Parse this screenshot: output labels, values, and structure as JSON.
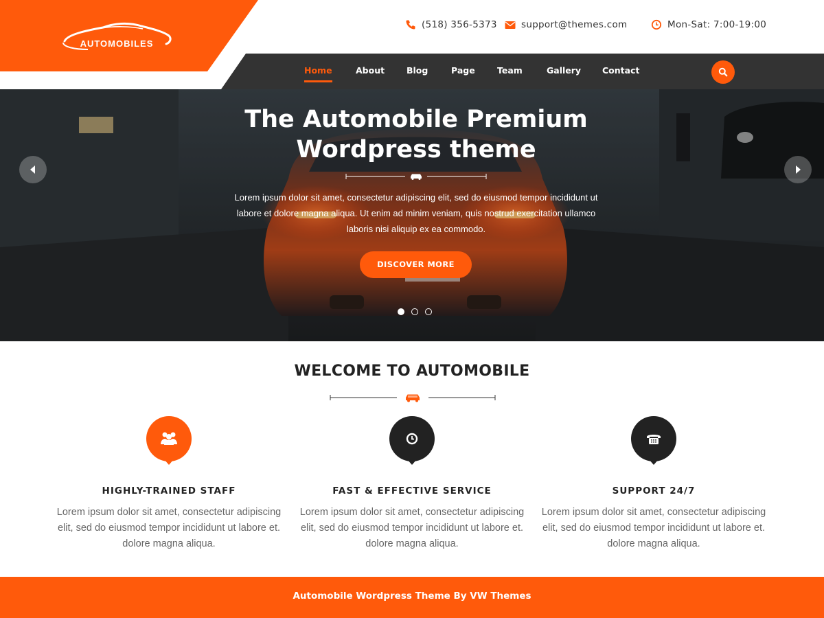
{
  "brand": {
    "name": "AUTOMOBILES",
    "accent": "#ff5a0b",
    "dark": "#333333"
  },
  "topbar": {
    "phone": "(518) 356-5373",
    "email": "support@themes.com",
    "hours": "Mon-Sat: 7:00-19:00",
    "phone_icon": "phone-icon",
    "email_icon": "envelope-icon",
    "hours_icon": "clock-icon"
  },
  "nav": {
    "items": [
      {
        "label": "Home",
        "active": true
      },
      {
        "label": "About",
        "active": false
      },
      {
        "label": "Blog",
        "active": false
      },
      {
        "label": "Page",
        "active": false
      },
      {
        "label": "Team",
        "active": false
      },
      {
        "label": "Gallery",
        "active": false
      },
      {
        "label": "Contact",
        "active": false
      }
    ],
    "search_icon": "search-icon"
  },
  "hero": {
    "title_line1": "The Automobile Premium",
    "title_line2": "Wordpress theme",
    "description": "Lorem ipsum dolor sit amet, consectetur adipiscing elit, sed do eiusmod tempor incididunt ut labore et dolore magna aliqua. Ut enim ad minim veniam, quis nostrud exercitation ullamco laboris nisi aliquip ex ea commodo.",
    "button_label": "DISCOVER MORE",
    "slides": 3,
    "active_slide": 1
  },
  "welcome": {
    "title": "WELCOME TO AUTOMOBILE",
    "features": [
      {
        "icon": "group-icon",
        "color": "#ff5a0b",
        "title": "HIGHLY-TRAINED STAFF",
        "text": "Lorem ipsum dolor sit amet, consectetur adipiscing elit, sed do eiusmod tempor incididunt ut labore et. dolore magna aliqua."
      },
      {
        "icon": "clock-icon",
        "color": "#222222",
        "title": "FAST & EFFECTIVE SERVICE",
        "text": "Lorem ipsum dolor sit amet, consectetur adipiscing elit, sed do eiusmod tempor incididunt ut labore et. dolore magna aliqua."
      },
      {
        "icon": "telephone-icon",
        "color": "#222222",
        "title": "SUPPORT 24/7",
        "text": "Lorem ipsum dolor sit amet, consectetur adipiscing elit, sed do eiusmod tempor incididunt ut labore et. dolore magna aliqua."
      }
    ]
  },
  "footer": {
    "text": "Automobile Wordpress Theme By VW Themes"
  }
}
